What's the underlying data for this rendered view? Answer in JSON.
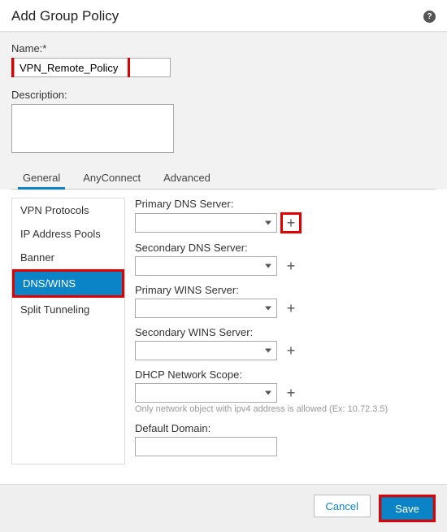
{
  "header": {
    "title": "Add Group Policy"
  },
  "fields": {
    "name_label": "Name:*",
    "name_value": "VPN_Remote_Policy",
    "description_label": "Description:",
    "description_value": ""
  },
  "tabs": [
    {
      "label": "General",
      "active": true
    },
    {
      "label": "AnyConnect",
      "active": false
    },
    {
      "label": "Advanced",
      "active": false
    }
  ],
  "sidebar": {
    "items": [
      {
        "label": "VPN Protocols",
        "active": false,
        "highlight": false
      },
      {
        "label": "IP Address Pools",
        "active": false,
        "highlight": false
      },
      {
        "label": "Banner",
        "active": false,
        "highlight": false
      },
      {
        "label": "DNS/WINS",
        "active": true,
        "highlight": true
      },
      {
        "label": "Split Tunneling",
        "active": false,
        "highlight": false
      }
    ]
  },
  "form": {
    "primary_dns_label": "Primary DNS Server:",
    "primary_dns_value": "",
    "secondary_dns_label": "Secondary DNS Server:",
    "secondary_dns_value": "",
    "primary_wins_label": "Primary WINS Server:",
    "primary_wins_value": "",
    "secondary_wins_label": "Secondary WINS Server:",
    "secondary_wins_value": "",
    "dhcp_scope_label": "DHCP Network Scope:",
    "dhcp_scope_value": "",
    "dhcp_hint": "Only network object with ipv4 address is allowed (Ex: 10.72.3.5)",
    "default_domain_label": "Default Domain:",
    "default_domain_value": ""
  },
  "footer": {
    "cancel_label": "Cancel",
    "save_label": "Save"
  },
  "highlight": {
    "primary_dns_add": true,
    "save_button": true,
    "name_field": true
  }
}
